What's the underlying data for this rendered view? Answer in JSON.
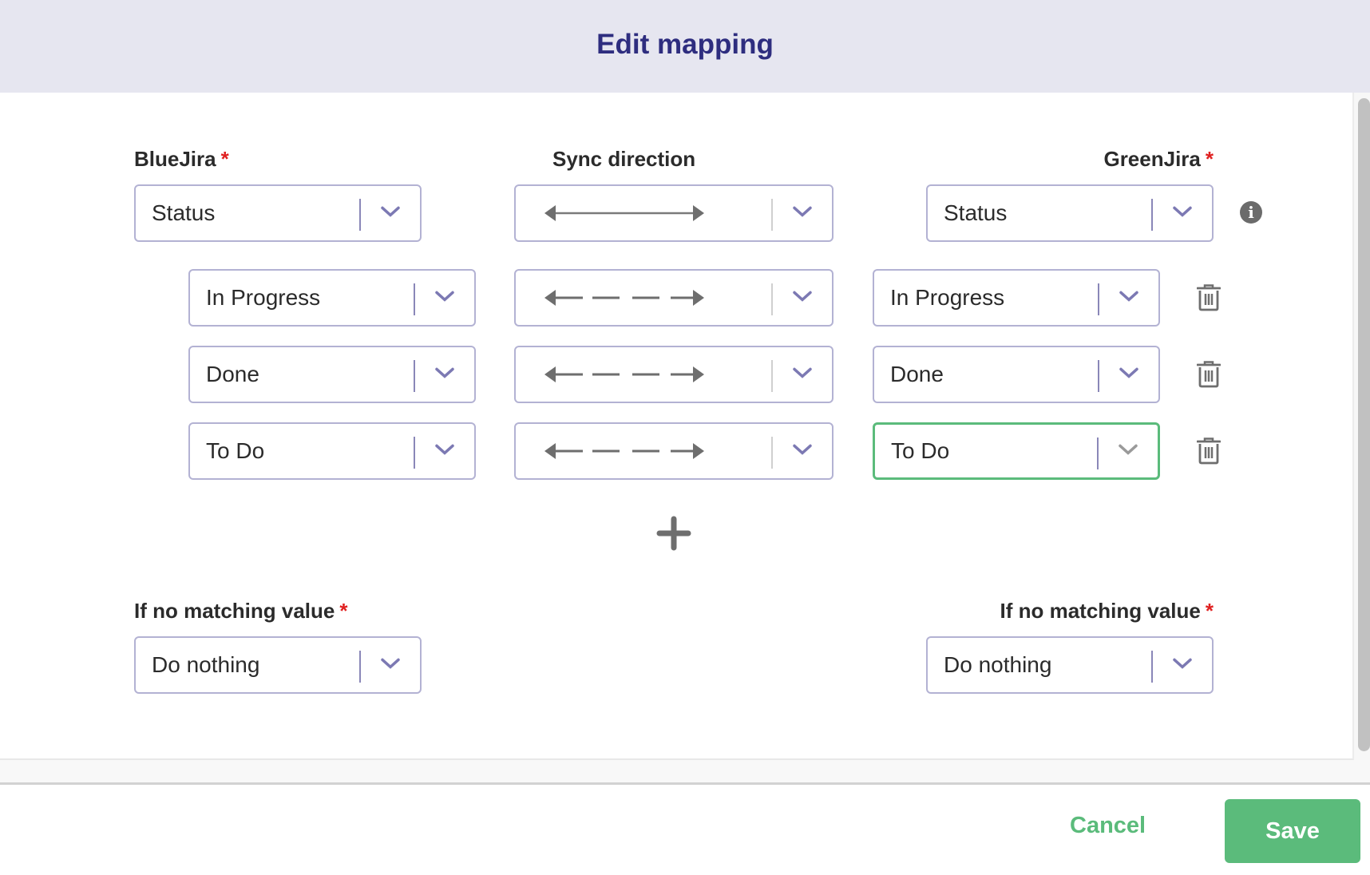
{
  "dialog": {
    "title": "Edit mapping"
  },
  "columns": {
    "left_label": "BlueJira",
    "middle_label": "Sync direction",
    "right_label": "GreenJira",
    "required_marker": "*"
  },
  "field_mapping": {
    "left_field": "Status",
    "direction": "bidirectional",
    "right_field": "Status"
  },
  "value_mappings": [
    {
      "left": "In Progress",
      "direction": "bidirectional-dashed",
      "right": "In Progress"
    },
    {
      "left": "Done",
      "direction": "bidirectional-dashed",
      "right": "Done"
    },
    {
      "left": "To Do",
      "direction": "bidirectional-dashed",
      "right": "To Do",
      "right_focused": true
    }
  ],
  "no_match": {
    "left_label": "If no matching value",
    "left_value": "Do nothing",
    "right_label": "If no matching value",
    "right_value": "Do nothing"
  },
  "icons": {
    "info": "info-icon",
    "delete": "trash-icon",
    "add": "plus-icon",
    "dropdown": "chevron-down-icon"
  },
  "footer": {
    "cancel_label": "Cancel",
    "save_label": "Save"
  },
  "colors": {
    "header_bg": "#e6e6f0",
    "title": "#2e2d7f",
    "accent_green": "#5bbb7b",
    "select_border": "#b3b2d3",
    "required": "#e02020"
  }
}
